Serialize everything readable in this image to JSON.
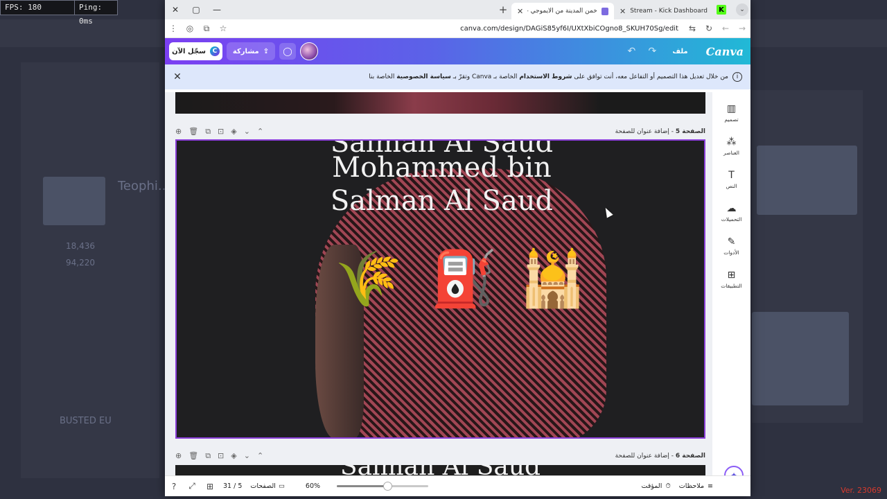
{
  "overlay": {
    "fps": "FPS: 180",
    "ping": "Ping: 0ms",
    "version": "Ver. 23069"
  },
  "background": {
    "left_items": [
      "Teophi...",
      "BUSTED EU"
    ],
    "stats": [
      "18,436",
      "94,220"
    ]
  },
  "browser": {
    "tabs": [
      {
        "label": "خمن المدينة من الايموجي - عرض",
        "state": "active"
      },
      {
        "label": "Stream - Kick Dashboard",
        "state": "inactive"
      }
    ],
    "new_tab": "+",
    "window_controls": {
      "close": "✕",
      "maximize": "▢",
      "minimize": "—"
    },
    "url": "canva.com/design/DAGiS85yf6I/UXtXbiCOgno8_SKUH70Sg/edit"
  },
  "canva": {
    "signin_label": "سجّل الآن",
    "share_label": "مشاركة",
    "file_label": "ملف",
    "logo": "Canva",
    "notice": {
      "part1": "من خلال تعديل هذا التصميم أو التفاعل معه، أنت توافق على ",
      "terms": "شروط الاستخدام",
      "part2": " الخاصة بـ Canva وتقرّ بـ ",
      "privacy": "سياسة الخصوصية",
      "part3": " الخاصة بنا"
    },
    "side_panel": [
      "تصميم",
      "العناصر",
      "النص",
      "التحميلات",
      "الأدوات",
      "التطبيقات"
    ],
    "page5": {
      "number": "الصفحة 5",
      "title": "إضافة عنوان للصفحة"
    },
    "page6": {
      "number": "الصفحة 6",
      "title": "إضافة عنوان للصفحة"
    },
    "headline_lines": [
      "Salman Al Saud",
      "Mohammed bin",
      "Salman Al Saud"
    ],
    "emojis": [
      "🌾",
      "⛽",
      "🕌"
    ],
    "bottom": {
      "notes": "ملاحظات",
      "timer": "المؤقت",
      "zoom": "60%",
      "zoom_fraction": 0.55,
      "pages_label": "الصفحات",
      "page_count": "31 / 5"
    }
  }
}
